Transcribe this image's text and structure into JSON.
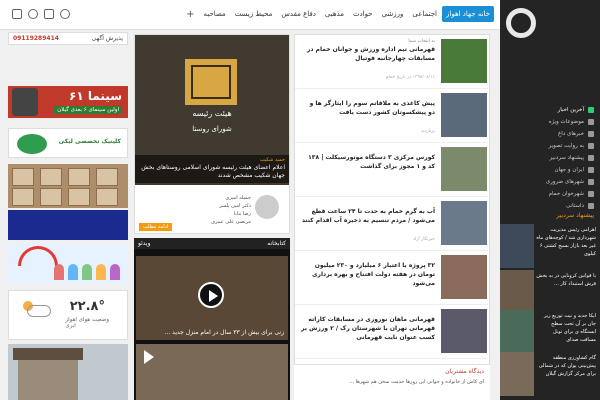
{
  "topnav": {
    "items": [
      "خانه جهاد اهواز",
      "اجتماعی",
      "ورزشی",
      "حوادث",
      "مذهبی",
      "دفاع مقدس",
      "محیط زیست",
      "مصاحبه"
    ],
    "active_index": 0,
    "plus_icon": "plus-icon"
  },
  "socials": [
    "telegram-icon",
    "instagram-icon",
    "phone-icon",
    "bale-icon"
  ],
  "left": {
    "phone": "09119289414",
    "phone_label": "پذیرش آگهی",
    "ad1_title": "سینما ۶۱",
    "ad1_sub": "اولین سینمای ۶ بعدی گیلان",
    "ad2_title": "کلینیک تخصصی لیکی",
    "weather_temp": "۲۲.۸°",
    "weather_city": "وضعیت هوای اهواز",
    "weather_cond": "ابری"
  },
  "featured": {
    "title": "هیئت رئیسه",
    "subtitle": "شورای روستا",
    "cat": "حمید شکیب",
    "caption": "اعلام اعضای هیئت رئیسه شورای اسلامی روستاهای بخش جهان شکیب مشخص شدند",
    "sub_items": [
      "جمیله امیری",
      "دکتر امین پلسر",
      "رضا بنابا",
      "مرتضی علی عمری"
    ],
    "more": "ادامه مطلب"
  },
  "videos": {
    "header": "ویدئو",
    "label": "کتابخانه",
    "v1_caption": "زنی برای بیش از ۳۳ سال در امام منزل جدید ...",
    "v2_caption": ""
  },
  "news": [
    {
      "cat": "به انتخاب شما",
      "title": "قهرمانی تیم اداره ورزش و جوانان خمام در مسابقات چهارجانبه فوتبال",
      "meta": "۱۳۹۸/۰۸/۱۱ در تاریخ خمام"
    },
    {
      "cat": "",
      "title": "پیش کاغذی به ملاقاتم سوم را ایثارگر ها و دو پیشکسوتان کشور دست یافت",
      "meta": "پربازدید"
    },
    {
      "cat": "",
      "title": "کورس مرکزی ۳ دستگاه موتورسیکلت | ۱۳۸ کد و ۱ مجوز برای گذاشت",
      "meta": ""
    },
    {
      "cat": "",
      "title": "آب به گرم خمام به حدت تا ۲۴ ساعت قطع می‌شود / مردم تنسیم به ذخیره آب اقدام کنند",
      "meta": "خبرنگار آزاد"
    },
    {
      "cat": "",
      "title": "۳۲ پروژه با اعتبار ۶ میلیارد و ۲۳۰ میلیون تومان در هفته دولت افتتاح و بهره برداری می‌شود",
      "meta": ""
    },
    {
      "cat": "",
      "title": "قهرمانی ماهان نوروزی در مسابقات کاراته قهرمانی تهران با شهرستان رک / ۲ ورزش بر کسب عنوان نایب قهرمانی",
      "meta": ""
    }
  ],
  "readers": {
    "heading": "دیدگاه مشتریان",
    "text": "ای کاش از خانواده و جوانی این روزها خدمت سخن هم شهرها ..."
  },
  "sidebar": {
    "items": [
      "آخرین اخبار",
      "موضوعات ویژه",
      "خبرهای داغ",
      "به روایت تصویر",
      "پیشنهاد سردبیر",
      "ایران و جهان",
      "شهرهای ضروری",
      "شهرخوان خمام",
      "داستانی"
    ],
    "hot_index": 0,
    "suggest_heading": "پیشنهاد سردبیر",
    "suggest": [
      "اهرامی رئیس مدیریت شهرداری شد / کوچه‌های ماه غیر بعد بازار بسیج کشتی ۶ کیلوی",
      "با قوانین کرونایی در به بخش فرش استبداد کار ...",
      "ایکا جدید و نیت توزیع زیر جان بر آن تحت سطح ایستگاه ی برای تونل مسافت صدای",
      "گام کشاورزی منطقه پیش‌بینی یوان که در شمالی برای مرکز گزارش گیلان"
    ]
  }
}
